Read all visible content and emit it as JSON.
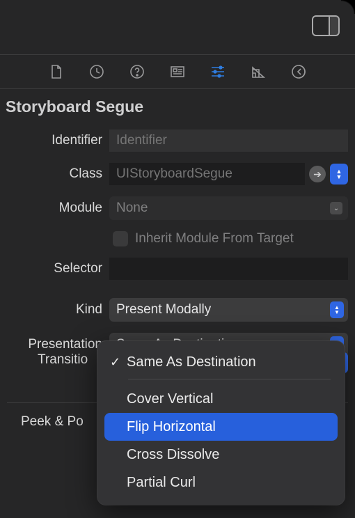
{
  "header": {
    "section_title": "Storyboard Segue"
  },
  "tabs": {
    "active_index": 4
  },
  "form": {
    "identifier": {
      "label": "Identifier",
      "placeholder": "Identifier",
      "value": ""
    },
    "class": {
      "label": "Class",
      "placeholder": "UIStoryboardSegue",
      "value": ""
    },
    "module": {
      "label": "Module",
      "value": "None"
    },
    "inherit": {
      "label": "Inherit Module From Target",
      "checked": false
    },
    "selector": {
      "label": "Selector",
      "value": ""
    },
    "kind": {
      "label": "Kind",
      "value": "Present Modally"
    },
    "presentation": {
      "label": "Presentation",
      "value": "Same As Destination"
    },
    "transition": {
      "label": "Transition"
    }
  },
  "peek": {
    "label": "Peek & Pop"
  },
  "popup": {
    "options": [
      "Same As Destination",
      "Cover Vertical",
      "Flip Horizontal",
      "Cross Dissolve",
      "Partial Curl"
    ],
    "current": "Same As Destination",
    "highlighted": "Flip Horizontal"
  }
}
